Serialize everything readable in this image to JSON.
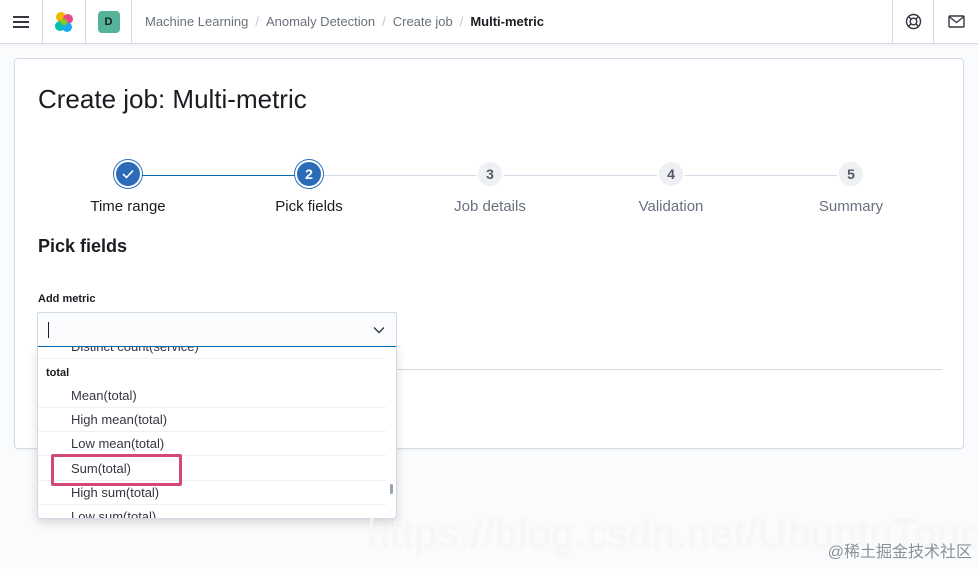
{
  "header": {
    "space_initial": "D",
    "breadcrumbs": [
      "Machine Learning",
      "Anomaly Detection",
      "Create job",
      "Multi-metric"
    ],
    "separator": "/"
  },
  "page": {
    "title": "Create job: Multi-metric"
  },
  "steps": [
    {
      "number": "",
      "title": "Time range",
      "status": "complete"
    },
    {
      "number": "2",
      "title": "Pick fields",
      "status": "current"
    },
    {
      "number": "3",
      "title": "Job details",
      "status": "incomplete"
    },
    {
      "number": "4",
      "title": "Validation",
      "status": "incomplete"
    },
    {
      "number": "5",
      "title": "Summary",
      "status": "incomplete"
    }
  ],
  "section": {
    "title": "Pick fields",
    "add_metric_label": "Add metric",
    "combo_value": ""
  },
  "dropdown": {
    "partial_option": "Distinct count(service)",
    "group_label": "total",
    "options": [
      "Mean(total)",
      "High mean(total)",
      "Low mean(total)",
      "Sum(total)",
      "High sum(total)",
      "Low sum(total)"
    ],
    "highlighted_option": "Sum(total)"
  },
  "watermark": {
    "text": "https://blog.csdn.net/UbuntuTouch",
    "source": "@稀土掘金技术社区"
  },
  "colors": {
    "accent": "#006bb4",
    "step_active": "#2c6bb8",
    "highlight_box": "#d4487a",
    "avatar": "#54b399"
  }
}
